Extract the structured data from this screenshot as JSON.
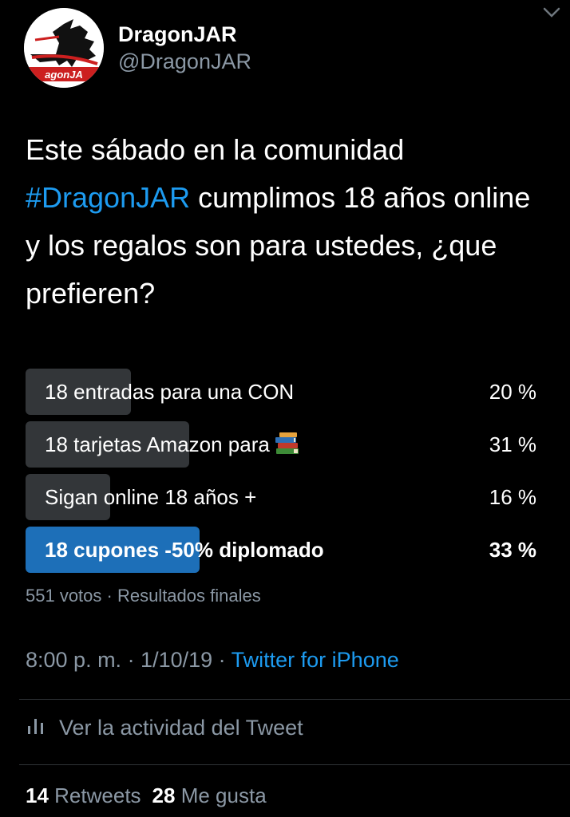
{
  "author": {
    "display_name": "DragonJAR",
    "handle": "@DragonJAR",
    "avatar_icon": "dragon-logo"
  },
  "tweet": {
    "text_before": "Este sábado en la comunidad ",
    "hashtag": "#DragonJAR",
    "text_after": " cumplimos 18 años online y los regalos son para ustedes, ¿que prefieren?"
  },
  "poll": {
    "options": [
      {
        "label": "18 entradas para una CON",
        "percent_label": "20 %",
        "percent": 20,
        "winner": false
      },
      {
        "label": "18 tarjetas Amazon para",
        "emoji_icon": "books-icon",
        "percent_label": "31 %",
        "percent": 31,
        "winner": false
      },
      {
        "label": "Sigan online 18 años +",
        "percent_label": "16 %",
        "percent": 16,
        "winner": false
      },
      {
        "label": "18 cupones -50% diplomado",
        "percent_label": "33 %",
        "percent": 33,
        "winner": true
      }
    ],
    "meta": "551 votos · Resultados finales"
  },
  "timestamp": "8:00 p. m. · 1/10/19 · ",
  "source": "Twitter for iPhone",
  "activity_label": "Ver la actividad del Tweet",
  "stats": {
    "retweets_count": "14",
    "retweets_label": "Retweets",
    "likes_count": "28",
    "likes_label": "Me gusta"
  },
  "colors": {
    "background": "#000000",
    "accent": "#1d9bf0",
    "winner_bar": "#1d6fb8",
    "bar": "#333639",
    "secondary_text": "#8b98a5"
  }
}
